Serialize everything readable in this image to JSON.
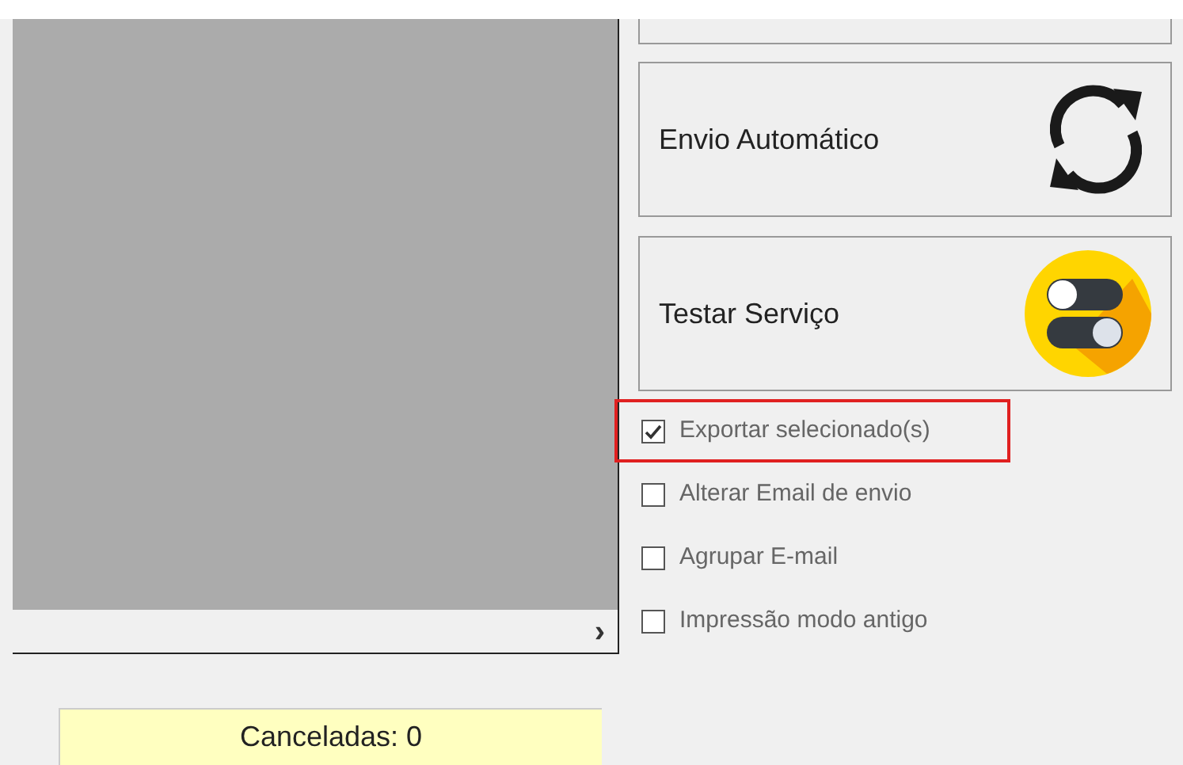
{
  "actions": [
    {
      "label": "Envio Automático",
      "kind": "sync"
    },
    {
      "label": "Testar Serviço",
      "kind": "toggle"
    }
  ],
  "options": [
    {
      "label": "Exportar selecionado(s)",
      "checked": true,
      "highlighted": true
    },
    {
      "label": "Alterar Email de envio",
      "checked": false,
      "highlighted": false
    },
    {
      "label": "Agrupar E-mail",
      "checked": false,
      "highlighted": false
    },
    {
      "label": "Impressão modo antigo",
      "checked": false,
      "highlighted": false
    }
  ],
  "scroll_arrow": "›",
  "status": "Canceladas: 0"
}
